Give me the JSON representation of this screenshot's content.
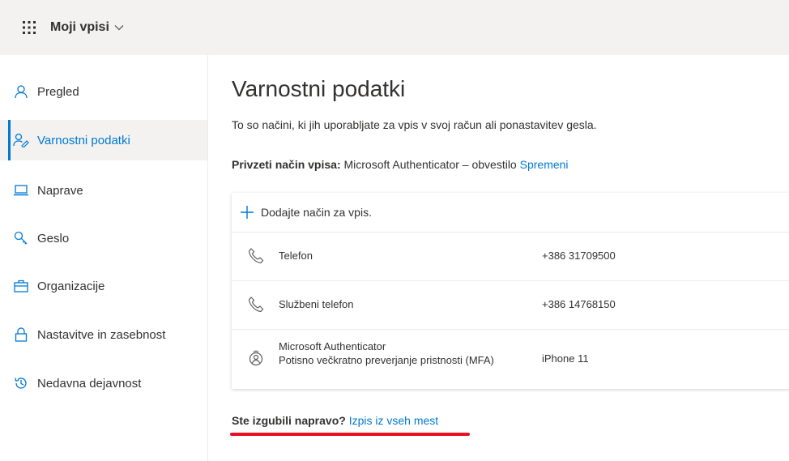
{
  "topbar": {
    "app_title": "Moji vpisi",
    "waffle_icon": "waffle-icon",
    "chevron_icon": "chevron-down-icon"
  },
  "sidebar": {
    "items": [
      {
        "label": "Pregled",
        "icon": "person-icon",
        "active": false
      },
      {
        "label": "Varnostni podatki",
        "icon": "security-info-icon",
        "active": true
      },
      {
        "label": "Naprave",
        "icon": "laptop-icon",
        "active": false
      },
      {
        "label": "Geslo",
        "icon": "key-icon",
        "active": false
      },
      {
        "label": "Organizacije",
        "icon": "briefcase-icon",
        "active": false
      },
      {
        "label": "Nastavitve in zasebnost",
        "icon": "lock-icon",
        "active": false
      },
      {
        "label": "Nedavna dejavnost",
        "icon": "history-icon",
        "active": false
      }
    ]
  },
  "main": {
    "title": "Varnostni podatki",
    "description": "To so načini, ki jih uporabljate za vpis v svoj račun ali ponastavitev gesla.",
    "default_method_label": "Privzeti način vpisa:",
    "default_method_value": "Microsoft Authenticator – obvestilo",
    "change_link": "Spremeni",
    "add_method": "Dodajte način za vpis.",
    "methods": [
      {
        "icon": "phone-icon",
        "name": "Telefon",
        "value": "+386 31709500"
      },
      {
        "icon": "phone-icon",
        "name": "Službeni telefon",
        "value": "+386 14768150"
      },
      {
        "icon": "authenticator-icon",
        "name": "Microsoft Authenticator",
        "subtitle": "Potisno večkratno preverjanje pristnosti (MFA)",
        "value": "iPhone 11"
      }
    ],
    "lost_device_question": "Ste izgubili napravo?",
    "lost_device_link": "Izpis iz vseh mest"
  },
  "colors": {
    "accent": "#0078d4",
    "annotation_underline": "#e81123",
    "topbar_bg": "#f3f2f1"
  }
}
